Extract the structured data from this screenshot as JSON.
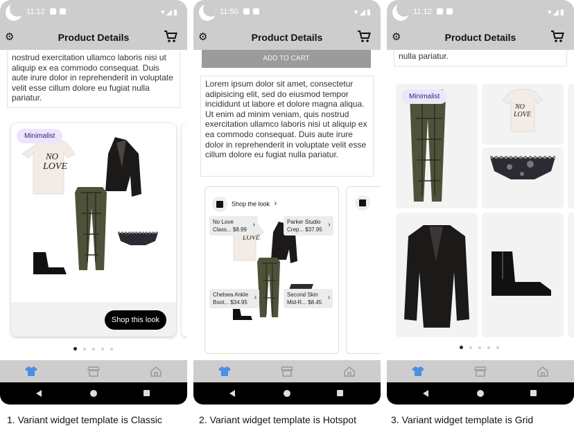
{
  "app": {
    "title": "Product Details",
    "status_icons": "▾◢▮"
  },
  "description": {
    "full": "Lorem ipsum dolor sit amet, consectetur adipisicing elit, sed do eiusmod tempor incididunt ut labore et dolore magna aliqua. Ut enim ad minim veniam, quis nostrud exercitation ullamco laboris nisi ut aliquip ex ea commodo consequat. Duis aute irure dolor in reprehenderit in voluptate velit esse cillum dolore eu fugiat nulla pariatur.",
    "tail_classic": "nostrud exercitation ullamco laboris nisi ut aliquip ex ea commodo consequat. Duis aute irure dolor in reprehenderit in voluptate velit esse cillum dolore eu fugiat nulla pariatur.",
    "tail_grid": "nulla pariatur."
  },
  "screens": [
    {
      "time": "11:12",
      "caption": "1. Variant widget template is Classic",
      "chip": "Minimalist",
      "shop_button": "Shop this look"
    },
    {
      "time": "11:50",
      "caption": "2. Variant widget template is Hotspot",
      "add_to_cart": "ADD TO CART",
      "shop_the_look": "Shop the look",
      "hotspots": [
        {
          "name": "No Love",
          "sub": "Class...",
          "price": "$8.99"
        },
        {
          "name": "Parker Studio",
          "sub": "Crep...",
          "price": "$37.95"
        },
        {
          "name": "Chelsea Ankle",
          "sub": "Boot...",
          "price": "$34.95"
        },
        {
          "name": "Second Skin",
          "sub": "Mid-R...",
          "price": "$8.45"
        }
      ]
    },
    {
      "time": "11:12",
      "caption": "3. Variant widget template is Grid",
      "chip": "Minimalist"
    }
  ],
  "carousel": {
    "count": 5,
    "active": 1
  },
  "nav": [
    "shirt-icon",
    "store-icon",
    "home-icon"
  ],
  "colors": {
    "bar_gray": "#cdcdcd",
    "chip_bg": "#ece6fb",
    "chip_text": "#3a1b78",
    "nav_active": "#4a90e2",
    "nav_inactive": "#9a9a9a",
    "add_to_cart_bg": "#9b9b9b"
  }
}
